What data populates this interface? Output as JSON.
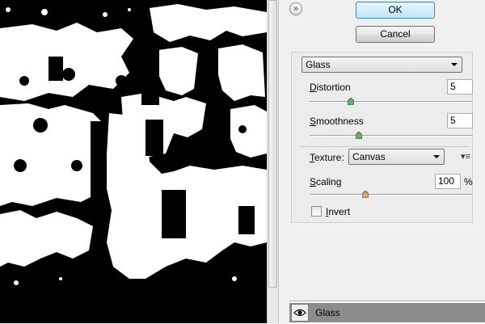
{
  "dialog": {
    "ok_label": "OK",
    "cancel_label": "Cancel"
  },
  "filter": {
    "selected": "Glass",
    "distortion": {
      "label_underlined": "D",
      "label_rest": "istortion",
      "value": "5",
      "level": 0.25
    },
    "smoothness": {
      "label_underlined": "S",
      "label_rest": "moothness",
      "value": "5",
      "level": 0.3
    },
    "texture": {
      "label_underlined": "T",
      "label_rest": "exture:",
      "selected": "Canvas"
    },
    "scaling": {
      "label_underlined": "S",
      "label_rest": "caling",
      "value": "100",
      "unit": "%",
      "level": 0.34
    },
    "invert": {
      "label_underlined": "I",
      "label_rest": "nvert",
      "checked": false
    }
  },
  "layers": [
    {
      "name": "Glass",
      "visible": true
    }
  ],
  "icons": {
    "collapse": "double-chevron-up-icon",
    "texture_menu": "panel-menu-icon",
    "layer_visibility": "eye-icon"
  },
  "colors": {
    "ok_border": "#3c7fb1",
    "ok_fill": "#bee6fd",
    "slider_thumb": "#6fa86f",
    "scaling_thumb": "#c8a87a",
    "layer_row": "#8c8c8c"
  }
}
